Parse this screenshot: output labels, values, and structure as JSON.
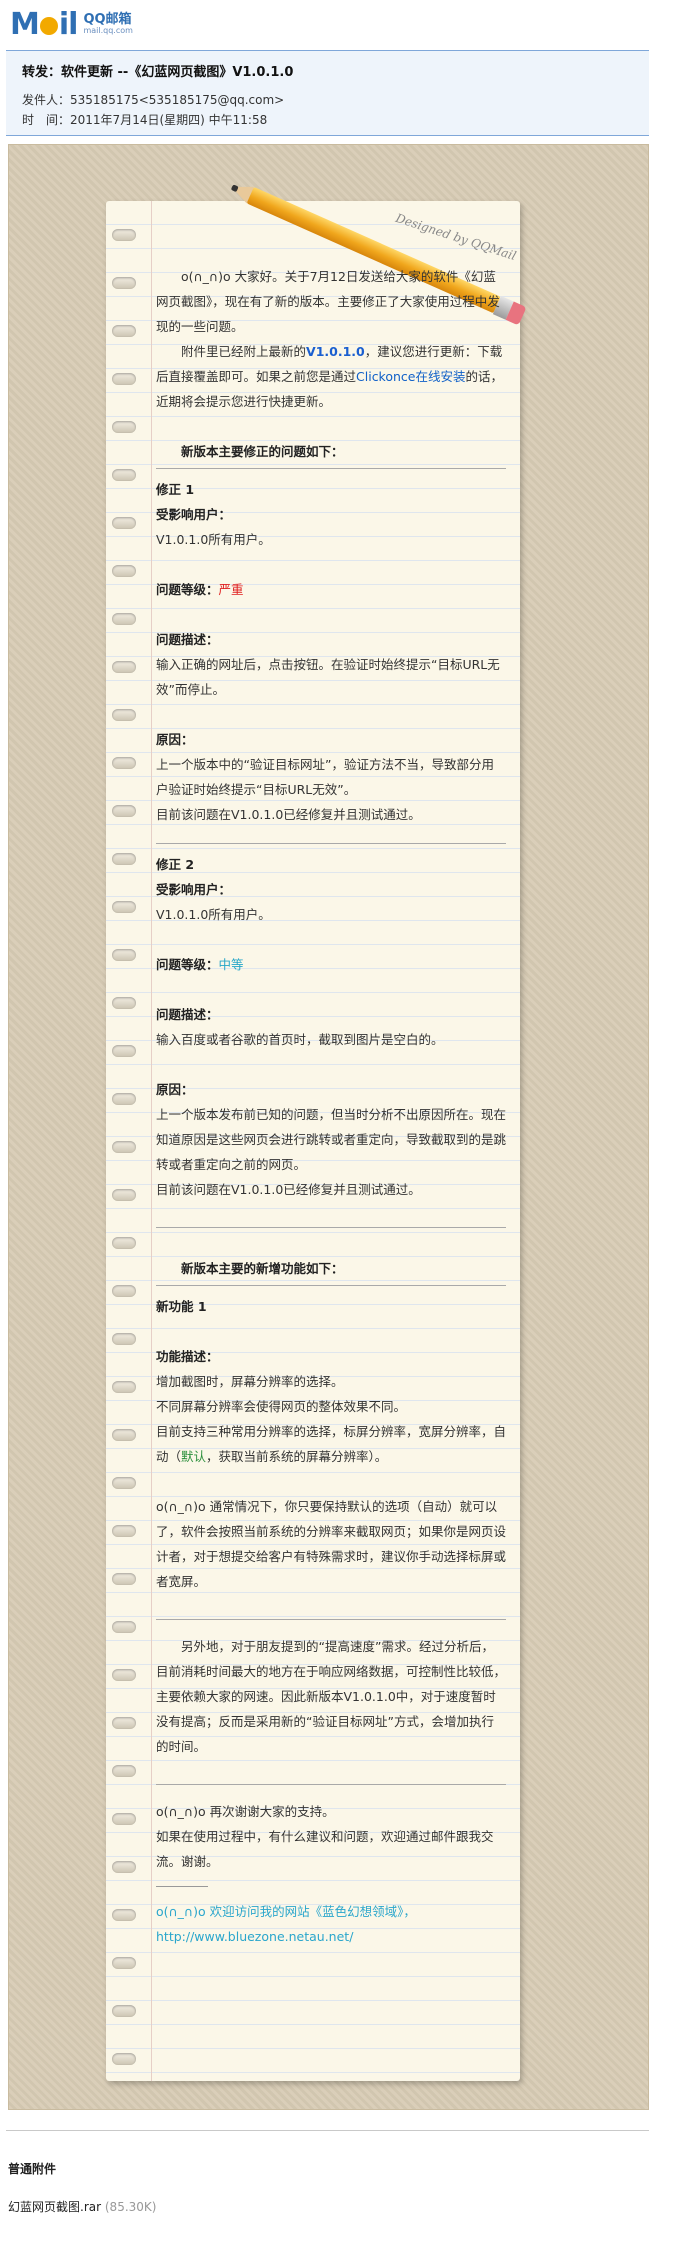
{
  "logo": {
    "brand_left": "M",
    "brand_right": "il",
    "brand_cn": "QQ邮箱",
    "brand_url": "mail.qq.com"
  },
  "mail": {
    "subject": "转发：软件更新  --《幻蓝网页截图》V1.0.1.0",
    "from_label": "发件人：",
    "from_value": "535185175<535185175@qq.com>",
    "time_label": "时　间：",
    "time_value": "2011年7月14日(星期四) 中午11:58"
  },
  "stationery": {
    "signature": "Designed by QQMail"
  },
  "letter": {
    "intro1": "o(∩_∩)o 大家好。关于7月12日发送给大家的软件《幻蓝网页截图》，现在有了新的版本。主要修正了大家使用过程中发现的一些问题。",
    "intro2_a": "附件里已经附上最新的",
    "intro2_version": "V1.0.1.0",
    "intro2_b": "，建议您进行更新：下载后直接覆盖即可。如果之前您是通过",
    "intro2_link": "Clickonce在线安装",
    "intro2_c": "的话，近期将会提示您进行快捷更新。",
    "section1_title": "新版本主要修正的问题如下：",
    "fix1": {
      "title": "修正 1",
      "users_label": "受影响用户：",
      "users": "V1.0.1.0所有用户。",
      "level_label": "问题等级：",
      "level": "严重",
      "desc_label": "问题描述：",
      "desc": "输入正确的网址后，点击按钮。在验证时始终提示“目标URL无效”而停止。",
      "cause_label": "原因：",
      "cause": "上一个版本中的“验证目标网址”，验证方法不当，导致部分用户验证时始终提示“目标URL无效”。",
      "status": "目前该问题在V1.0.1.0已经修复并且测试通过。"
    },
    "fix2": {
      "title": "修正 2",
      "users_label": "受影响用户：",
      "users": "V1.0.1.0所有用户。",
      "level_label": "问题等级：",
      "level": "中等",
      "desc_label": "问题描述：",
      "desc": "输入百度或者谷歌的首页时，截取到图片是空白的。",
      "cause_label": "原因：",
      "cause": "上一个版本发布前已知的问题，但当时分析不出原因所在。现在知道原因是这些网页会进行跳转或者重定向，导致截取到的是跳转或者重定向之前的网页。",
      "status": "目前该问题在V1.0.1.0已经修复并且测试通过。"
    },
    "section2_title": "新版本主要的新增功能如下：",
    "feature1": {
      "title": "新功能 1",
      "desc_label": "功能描述：",
      "line1": "增加截图时，屏幕分辨率的选择。",
      "line2": "不同屏幕分辨率会使得网页的整体效果不同。",
      "line3_a": "目前支持三种常用分辨率的选择，标屏分辨率，宽屏分辨率，自动（",
      "line3_default": "默认",
      "line3_b": "，获取当前系统的屏幕分辨率）。",
      "note": "o(∩_∩)o  通常情况下，你只要保持默认的选项（自动）就可以了，软件会按照当前系统的分辨率来截取网页；如果你是网页设计者，对于想提交给客户有特殊需求时，建议你手动选择标屏或者宽屏。"
    },
    "speed_para": "另外地，对于朋友提到的“提高速度”需求。经过分析后，目前消耗时间最大的地方在于响应网络数据，可控制性比较低，主要依赖大家的网速。因此新版本V1.0.1.0中，对于速度暂时没有提高；反而是采用新的“验证目标网址”方式，会增加执行的时间。",
    "thanks1": "o(∩_∩)o 再次谢谢大家的支持。",
    "thanks2": "如果在使用过程中，有什么建议和问题，欢迎通过邮件跟我交流。谢谢。",
    "site_line": "o(∩_∩)o  欢迎访问我的网站《蓝色幻想领域》，",
    "site_url": "http://www.bluezone.netau.net/"
  },
  "attachments": {
    "title": "普通附件",
    "items": [
      {
        "name": "幻蓝网页截图.rar",
        "size": "(85.30K)"
      }
    ]
  },
  "colors": {
    "accent_blue": "#2f6fb3",
    "severe": "#e02020",
    "medium": "#26a6c8",
    "default_green": "#2b8f3c",
    "link_blue": "#1060c8"
  }
}
